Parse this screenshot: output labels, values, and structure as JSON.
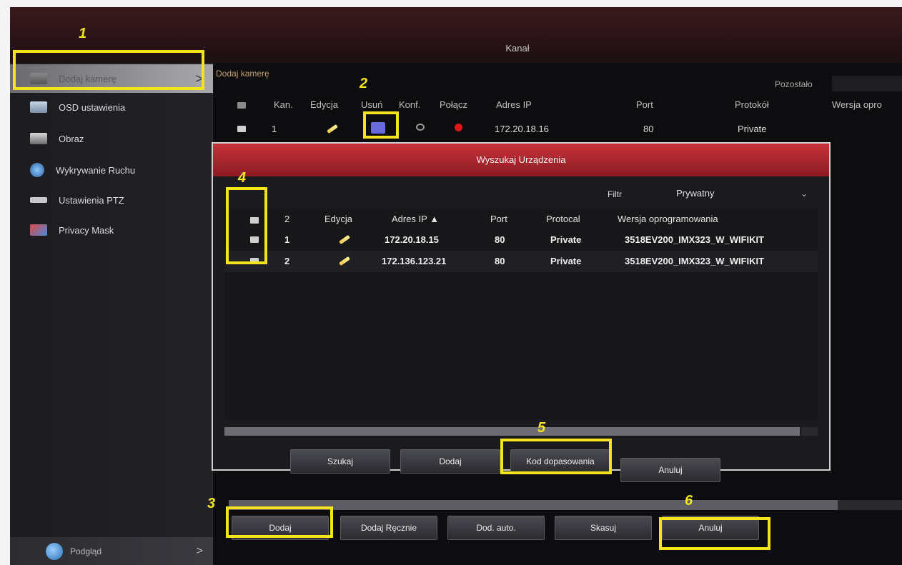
{
  "window_title": "Kanał",
  "sidebar": {
    "items": [
      {
        "label": "Dodaj kamerę",
        "icon": "camera-icon"
      },
      {
        "label": "OSD ustawienia",
        "icon": "osd-icon"
      },
      {
        "label": "Obraz",
        "icon": "image-icon"
      },
      {
        "label": "Wykrywanie Ruchu",
        "icon": "motion-icon"
      },
      {
        "label": "Ustawienia PTZ",
        "icon": "ptz-icon"
      },
      {
        "label": "Privacy Mask",
        "icon": "privacy-mask-icon"
      }
    ],
    "preview_label": "Podgląd"
  },
  "main": {
    "title": "Dodaj kamerę",
    "remaining_label": "Pozostało",
    "columns": [
      "Kan.",
      "Edycja",
      "Usuń",
      "Konf.",
      "Połącz",
      "Adres IP",
      "Port",
      "Protokół",
      "Wersja opro"
    ],
    "row": {
      "channel": "1",
      "ip": "172.20.18.16",
      "port": "80",
      "protocol": "Private"
    }
  },
  "dialog": {
    "title": "Wyszukaj Urządzenia",
    "filter_label": "Filtr",
    "filter_value": "Prywatny",
    "columns": [
      "2",
      "Edycja",
      "Adres IP ▲",
      "Port",
      "Protocal",
      "Wersja oprogramowania"
    ],
    "rows": [
      {
        "no": "1",
        "ip": "172.20.18.15",
        "port": "80",
        "protocol": "Private",
        "firmware": "3518EV200_IMX323_W_WIFIKIT"
      },
      {
        "no": "2",
        "ip": "172.136.123.21",
        "port": "80",
        "protocol": "Private",
        "firmware": "3518EV200_IMX323_W_WIFIKIT"
      }
    ],
    "buttons": {
      "search": "Szukaj",
      "add": "Dodaj",
      "match_code": "Kod dopasowania",
      "cancel": "Anuluj"
    }
  },
  "bottom_buttons": {
    "add": "Dodaj",
    "add_manual": "Dodaj Ręcznie",
    "add_auto": "Dod. auto.",
    "delete": "Skasuj",
    "cancel": "Anuluj"
  },
  "annotations": [
    "1",
    "2",
    "3",
    "4",
    "5",
    "6"
  ],
  "colors": {
    "highlight": "#f4e41d",
    "dialog_header": "#c8323b",
    "status_disconnected": "#e01818"
  }
}
